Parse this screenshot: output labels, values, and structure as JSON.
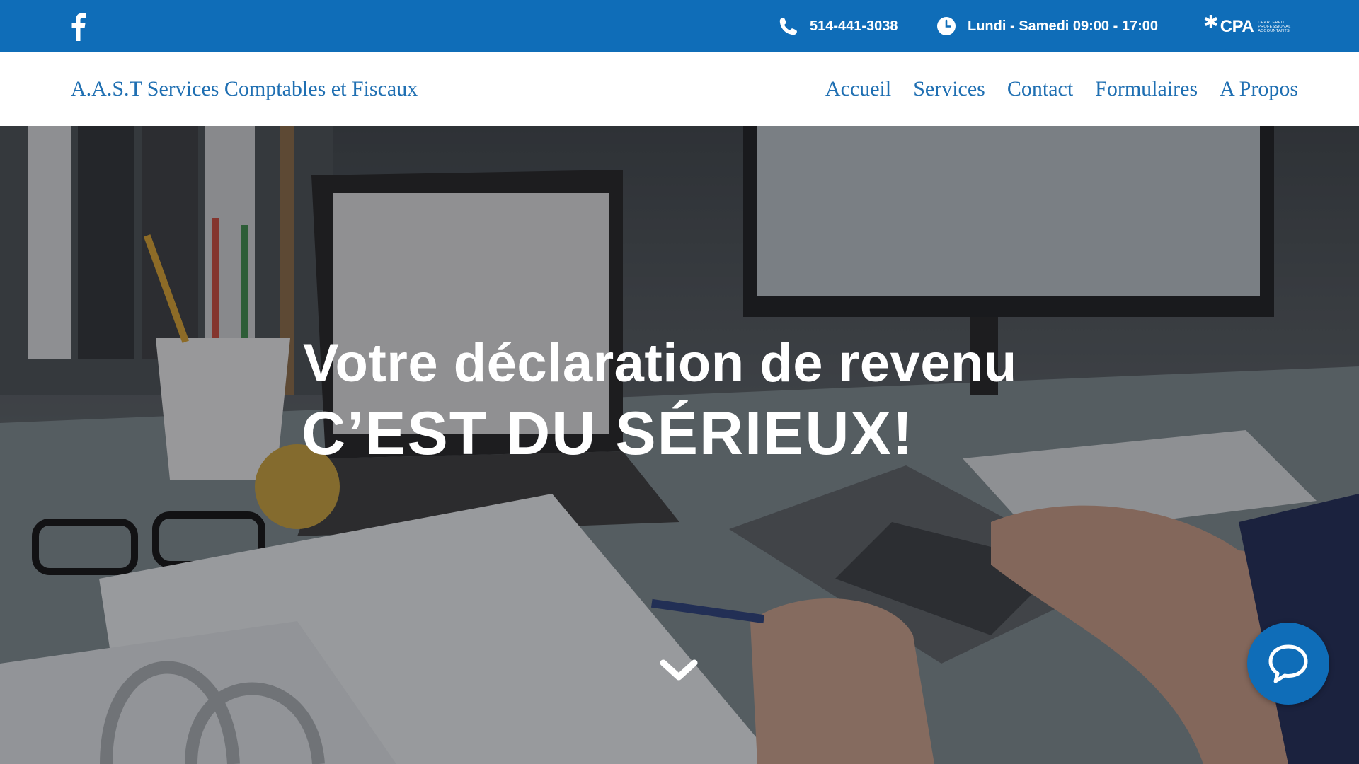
{
  "topbar": {
    "facebook_icon": "facebook-icon",
    "phone_icon": "phone-icon",
    "phone": "514-441-3038",
    "clock_icon": "clock-icon",
    "hours": "Lundi - Samedi 09:00 - 17:00",
    "cpa_logo": {
      "mark": "CPA",
      "tagline": "Chartered Professional Accountants"
    },
    "color": "#0f6db8"
  },
  "header": {
    "brand": "A.A.S.T Services Comptables et Fiscaux",
    "nav": [
      "Accueil",
      "Services",
      "Contact",
      "Formulaires",
      "A Propos"
    ],
    "link_color": "#1f6fb2"
  },
  "hero": {
    "line1": "Votre déclaration de revenu",
    "line2": "C’EST DU SÉRIEUX!",
    "scroll_icon": "chevron-down-icon"
  },
  "chat": {
    "icon": "chat-bubble-icon"
  }
}
